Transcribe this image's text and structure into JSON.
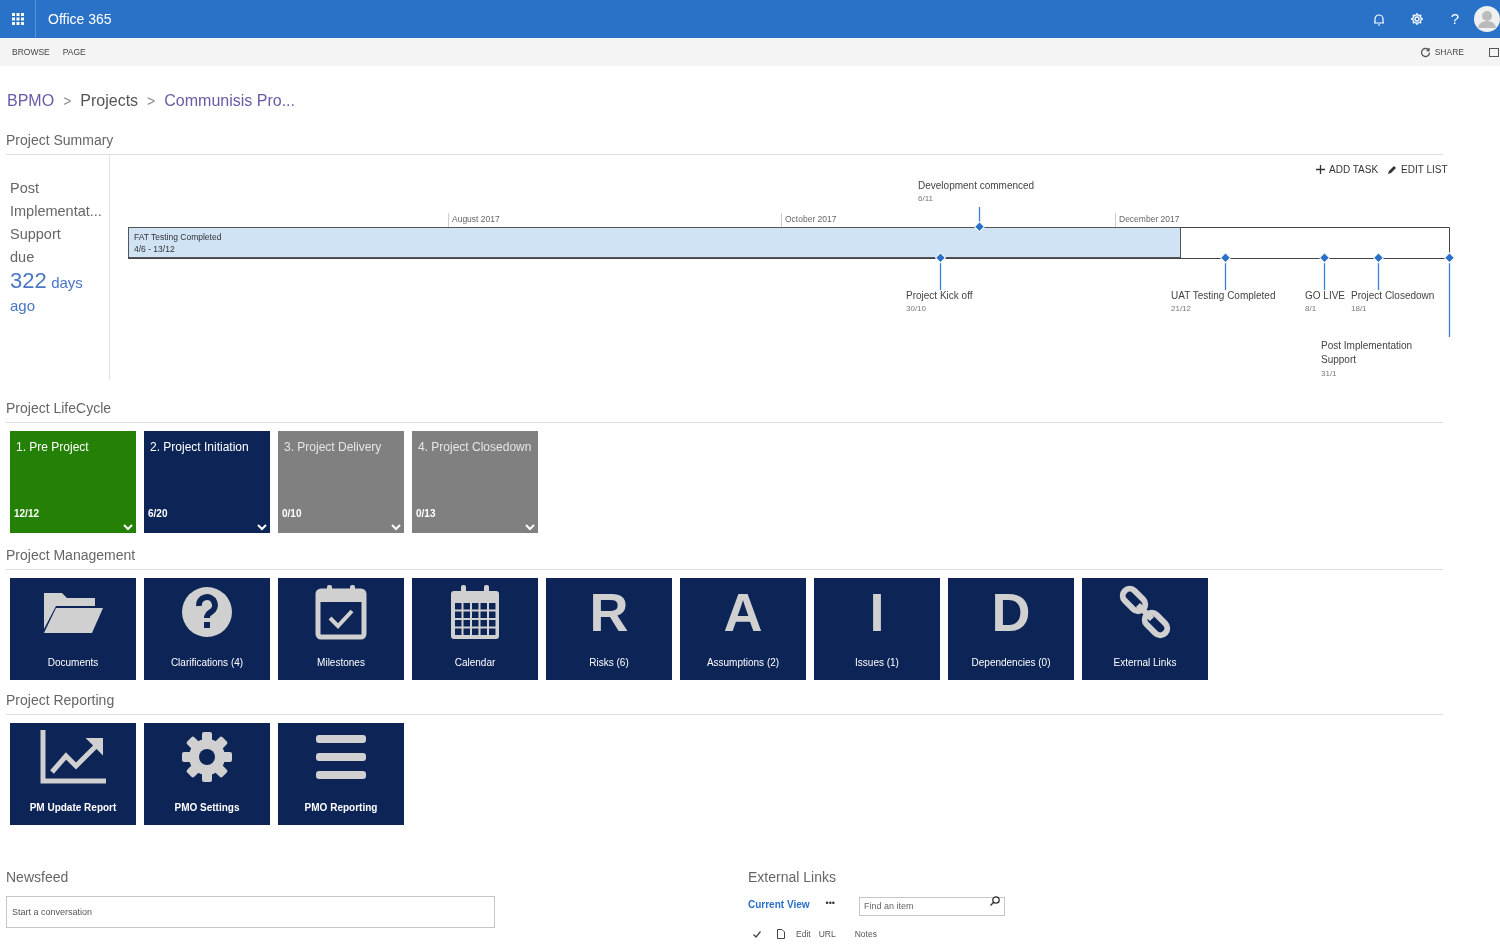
{
  "suite_bar": {
    "app_title": "Office 365",
    "help": "?"
  },
  "ribbon": {
    "tabs": [
      "BROWSE",
      "PAGE"
    ],
    "share": "SHARE"
  },
  "breadcrumb": [
    {
      "label": "BPMO",
      "link": true
    },
    {
      "label": "Projects",
      "link": false
    },
    {
      "label": "Communisis Pro...",
      "link": true
    }
  ],
  "breadcrumb_separator": ">",
  "summary": {
    "heading": "Project Summary",
    "countdown": {
      "label_lines": [
        "Post",
        "Implementat...",
        "Support",
        "due"
      ],
      "number": "322",
      "unit": "days",
      "suffix": "ago"
    },
    "timeline": {
      "actions": [
        "ADD TASK",
        "EDIT LIST"
      ],
      "months": [
        "August 2017",
        "October 2017",
        "December 2017"
      ],
      "task": {
        "title": "FAT Testing Completed",
        "dates": "4/6 - 13/12"
      },
      "milestones": [
        {
          "title": "Development commenced",
          "date": "6/11"
        },
        {
          "title": "Project Kick off",
          "date": "30/10"
        },
        {
          "title": "UAT Testing Completed",
          "date": "21/12"
        },
        {
          "title": "GO LIVE",
          "date": "8/1"
        },
        {
          "title": "Project Closedown",
          "date": "18/1"
        },
        {
          "title": "Post Implementation Support",
          "date": "31/1"
        }
      ]
    }
  },
  "lifecycle": {
    "heading": "Project LifeCycle",
    "stages": [
      {
        "title": "1. Pre Project",
        "count": "12/12",
        "color": "#258006"
      },
      {
        "title": "2. Project Initiation",
        "count": "6/20",
        "color": "#0c2456"
      },
      {
        "title": "3. Project Delivery",
        "count": "0/10",
        "color": "#808080"
      },
      {
        "title": "4. Project Closedown",
        "count": "0/13",
        "color": "#808080"
      }
    ]
  },
  "management": {
    "heading": "Project Management",
    "tiles": [
      {
        "kind": "icon",
        "label": "Documents"
      },
      {
        "kind": "icon",
        "label": "Clarifications (4)"
      },
      {
        "kind": "icon",
        "label": "Milestones"
      },
      {
        "kind": "icon",
        "label": "Calendar"
      },
      {
        "kind": "letter",
        "glyph": "R",
        "label": "Risks (6)"
      },
      {
        "kind": "letter",
        "glyph": "A",
        "label": "Assumptions (2)"
      },
      {
        "kind": "letter",
        "glyph": "I",
        "label": "Issues (1)"
      },
      {
        "kind": "letter",
        "glyph": "D",
        "label": "Dependencies (0)"
      },
      {
        "kind": "icon",
        "label": "External Links"
      }
    ]
  },
  "reporting": {
    "heading": "Project Reporting",
    "tiles": [
      {
        "kind": "icon",
        "label": "PM Update Report"
      },
      {
        "kind": "icon",
        "label": "PMO Settings"
      },
      {
        "kind": "icon",
        "label": "PMO Reporting"
      }
    ]
  },
  "newsfeed": {
    "heading": "Newsfeed",
    "placeholder": "Start a conversation"
  },
  "external_links": {
    "heading": "External Links",
    "view": "Current View",
    "more": "•••",
    "search": {
      "placeholder": "Find an item"
    },
    "columns": [
      "Edit",
      "URL",
      "Notes"
    ]
  }
}
